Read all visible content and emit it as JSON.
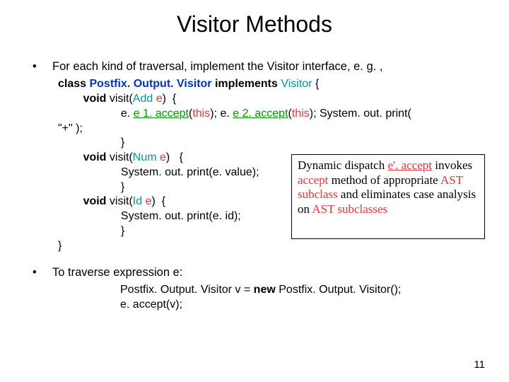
{
  "title": "Visitor Methods",
  "bullet1": "For each kind of traversal, implement the Visitor interface, e. g. ,",
  "code": {
    "l1_a": "class ",
    "l1_b": "Postfix. Output. Visitor",
    "l1_c": " implements ",
    "l1_d": "Visitor",
    "l1_e": " {",
    "l2_a": "        void ",
    "l2_b": "visit(",
    "l2_c": "Add",
    "l2_d": " e",
    "l2_e": ")  {",
    "l3_a": "                    e. ",
    "l3_b": "e 1. accept",
    "l3_c": "(",
    "l3_d": "this",
    "l3_e": "); e. ",
    "l3_f": "e 2. accept",
    "l3_g": "(",
    "l3_h": "this",
    "l3_i": "); System. out. print(",
    "l4": "\"+\" );",
    "l5": "                    }",
    "l6_a": "        void ",
    "l6_b": "visit(",
    "l6_c": "Num",
    "l6_d": " e",
    "l6_e": ")   {",
    "l7": "                    System. out. print(e. value);",
    "l8": "                    }",
    "l9_a": "        void ",
    "l9_b": "visit(",
    "l9_c": "Id",
    "l9_d": " e",
    "l9_e": ")  {",
    "l10": "                    System. out. print(e. id);",
    "l11": "                    }",
    "l12": "}"
  },
  "callout": {
    "t1": "Dynamic dispatch ",
    "t2": "e'. accept",
    "t3": " invokes ",
    "t4": "accept",
    "t5": " method of appropriate ",
    "t6": "AST subclass",
    "t7": " and eliminates case analysis on ",
    "t8": "AST subclasses"
  },
  "bullet2": "To traverse expression e:",
  "trav": {
    "l1_a": "Postfix. Output. Visitor v = ",
    "l1_b": "new",
    "l1_c": " Postfix. Output. Visitor();",
    "l2": "e. accept(v);"
  },
  "pagenum": "11"
}
